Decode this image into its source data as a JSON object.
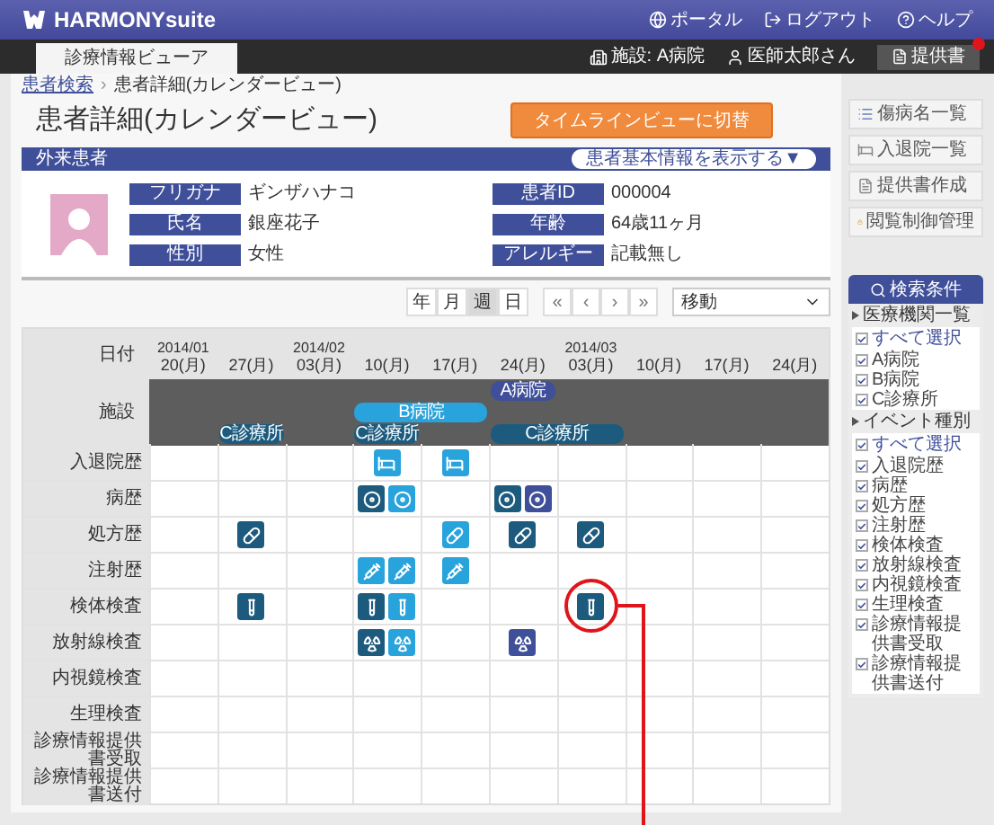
{
  "header": {
    "logo": "HARMONYsuite",
    "links": [
      "ポータル",
      "ログアウト",
      "ヘルプ"
    ]
  },
  "tabs": [
    {
      "label": "診療情報ビューア",
      "selected": true
    }
  ],
  "session": {
    "facility": "施設: A病院",
    "user": "医師太郎さん",
    "documents_button": "提供書"
  },
  "breadcrumb": [
    "患者検索",
    "›",
    "患者詳細(カレンダービュー)"
  ],
  "page_title": "患者詳細(カレンダービュー)",
  "switch_button": "タイムラインビューに切替",
  "patient": {
    "category": "外来患者",
    "toggle_button": "患者基本情報を表示する▼",
    "left_fields": [
      {
        "label": "フリガナ",
        "value": "ギンザハナコ"
      },
      {
        "label": "氏名",
        "value": "銀座花子"
      },
      {
        "label": "性別",
        "value": "女性"
      }
    ],
    "right_fields": [
      {
        "label": "患者ID",
        "value": "000004"
      },
      {
        "label": "年齢",
        "value": "64歳11ヶ月"
      },
      {
        "label": "アレルギー",
        "value": "記載無し"
      }
    ]
  },
  "pager": {
    "scales": [
      {
        "label": "年",
        "selected": false
      },
      {
        "label": "月",
        "selected": false
      },
      {
        "label": "週",
        "selected": true
      },
      {
        "label": "日",
        "selected": false
      }
    ],
    "nav": [
      "«",
      "‹",
      "›",
      "»"
    ],
    "jump_select": "移動"
  },
  "calendar": {
    "corner": "日付",
    "row_header_facility": "施設",
    "columns": [
      {
        "year": "2014/01",
        "day": "20(月)"
      },
      {
        "day": "27(月)"
      },
      {
        "year": "2014/02",
        "day": "03(月)"
      },
      {
        "day": "10(月)"
      },
      {
        "day": "17(月)"
      },
      {
        "day": "24(月)"
      },
      {
        "year": "2014/03",
        "day": "03(月)"
      },
      {
        "day": "10(月)"
      },
      {
        "day": "17(月)"
      },
      {
        "day": "24(月)"
      }
    ],
    "facility_lanes": [
      {
        "cells": [
          {},
          {},
          {},
          {},
          {},
          {
            "bars": [
              {
                "label": "A病院",
                "color": "#3f4f9a",
                "kind": "single"
              }
            ]
          },
          {},
          {},
          {},
          {}
        ]
      },
      {
        "cells": [
          {},
          {},
          {},
          {
            "bars": [
              {
                "label": "B病院",
                "color": "#29a3dc",
                "kind": "double"
              }
            ]
          },
          {},
          {},
          {},
          {},
          {},
          {}
        ]
      },
      {
        "cells": [
          {},
          {
            "bars": [
              {
                "label": "C診療所",
                "color": "#1d5b7e",
                "kind": "single"
              }
            ]
          },
          {},
          {
            "bars": [
              {
                "label": "C診療所",
                "color": "#1d5b7e",
                "kind": "single"
              }
            ]
          },
          {},
          {
            "bars": [
              {
                "label": "C診療所",
                "color": "#1d5b7e",
                "kind": "double"
              }
            ]
          },
          {},
          {},
          {},
          {}
        ]
      }
    ],
    "rows": [
      {
        "label": "入退院歴",
        "kind": "admission",
        "cells": [
          {},
          {},
          {},
          {
            "events": [
              {
                "color": "#29a3dc"
              }
            ]
          },
          {
            "events": [
              {
                "color": "#29a3dc"
              }
            ]
          },
          {},
          {},
          {},
          {},
          {}
        ]
      },
      {
        "label": "病歴",
        "kind": "history",
        "cells": [
          {},
          {},
          {},
          {
            "events": [
              {
                "color": "#1d5b7e"
              },
              {
                "color": "#29a3dc"
              }
            ]
          },
          {},
          {
            "events": [
              {
                "color": "#1d5b7e"
              },
              {
                "color": "#3f4f9a"
              }
            ]
          },
          {},
          {},
          {},
          {}
        ]
      },
      {
        "label": "処方歴",
        "kind": "prescription",
        "cells": [
          {},
          {
            "events": [
              {
                "color": "#1d5b7e"
              }
            ]
          },
          {},
          {},
          {
            "events": [
              {
                "color": "#29a3dc"
              }
            ]
          },
          {
            "events": [
              {
                "color": "#1d5b7e"
              }
            ]
          },
          {
            "events": [
              {
                "color": "#1d5b7e"
              }
            ]
          },
          {},
          {},
          {}
        ]
      },
      {
        "label": "注射歴",
        "kind": "injection",
        "cells": [
          {},
          {},
          {},
          {
            "events": [
              {
                "color": "#29a3dc"
              },
              {
                "color": "#29a3dc"
              }
            ]
          },
          {
            "events": [
              {
                "color": "#29a3dc"
              }
            ]
          },
          {},
          {},
          {},
          {},
          {}
        ]
      },
      {
        "label": "検体検査",
        "kind": "specimen",
        "cells": [
          {},
          {
            "events": [
              {
                "color": "#1d5b7e"
              }
            ]
          },
          {},
          {
            "events": [
              {
                "color": "#1d5b7e"
              },
              {
                "color": "#29a3dc"
              }
            ]
          },
          {},
          {},
          {
            "events": [
              {
                "color": "#1d5b7e",
                "circled": true
              }
            ]
          },
          {},
          {},
          {}
        ]
      },
      {
        "label": "放射線検査",
        "kind": "radiology",
        "cells": [
          {},
          {},
          {},
          {
            "events": [
              {
                "color": "#1d5b7e"
              },
              {
                "color": "#29a3dc"
              }
            ]
          },
          {},
          {
            "events": [
              {
                "color": "#3f4f9a"
              }
            ]
          },
          {},
          {},
          {},
          {}
        ]
      },
      {
        "label": "内視鏡検査",
        "cells": [
          {},
          {},
          {},
          {},
          {},
          {},
          {},
          {},
          {},
          {}
        ]
      },
      {
        "label": "生理検査",
        "cells": [
          {},
          {},
          {},
          {},
          {},
          {},
          {},
          {},
          {},
          {}
        ]
      },
      {
        "label": "診療情報提供書受取",
        "cells": [
          {},
          {},
          {},
          {},
          {},
          {},
          {},
          {},
          {},
          {}
        ]
      },
      {
        "label": "診療情報提供書送付",
        "cells": [
          {},
          {},
          {},
          {},
          {},
          {},
          {},
          {},
          {},
          {}
        ]
      }
    ]
  },
  "side_buttons": [
    {
      "label": "傷病名一覧",
      "kind": "list"
    },
    {
      "label": "入退院一覧",
      "kind": "bed"
    },
    {
      "label": "提供書作成",
      "kind": "document"
    },
    {
      "label": "閲覧制御管理",
      "kind": "lock"
    }
  ],
  "search_button": "検索条件",
  "filters": [
    {
      "title": "医療機関一覧",
      "items": [
        {
          "label": "すべて選択",
          "kind": "all",
          "checked": true
        },
        {
          "label": "A病院",
          "kind": "option",
          "checked": true
        },
        {
          "label": "B病院",
          "kind": "option",
          "checked": true
        },
        {
          "label": "C診療所",
          "kind": "option",
          "checked": true
        }
      ]
    },
    {
      "title": "イベント種別",
      "items": [
        {
          "label": "すべて選択",
          "kind": "all",
          "checked": true
        },
        {
          "label": "入退院歴",
          "kind": "option",
          "checked": true
        },
        {
          "label": "病歴",
          "kind": "option",
          "checked": true
        },
        {
          "label": "処方歴",
          "kind": "option",
          "checked": true
        },
        {
          "label": "注射歴",
          "kind": "option",
          "checked": true
        },
        {
          "label": "検体検査",
          "kind": "option",
          "checked": true
        },
        {
          "label": "放射線検査",
          "kind": "option",
          "checked": true
        },
        {
          "label": "内視鏡検査",
          "kind": "option",
          "checked": true
        },
        {
          "label": "生理検査",
          "kind": "option",
          "checked": true
        },
        {
          "label": "診療情報提供書受取",
          "kind": "option",
          "checked": true
        },
        {
          "label": "診療情報提供書送付",
          "kind": "option",
          "checked": true
        }
      ]
    }
  ]
}
